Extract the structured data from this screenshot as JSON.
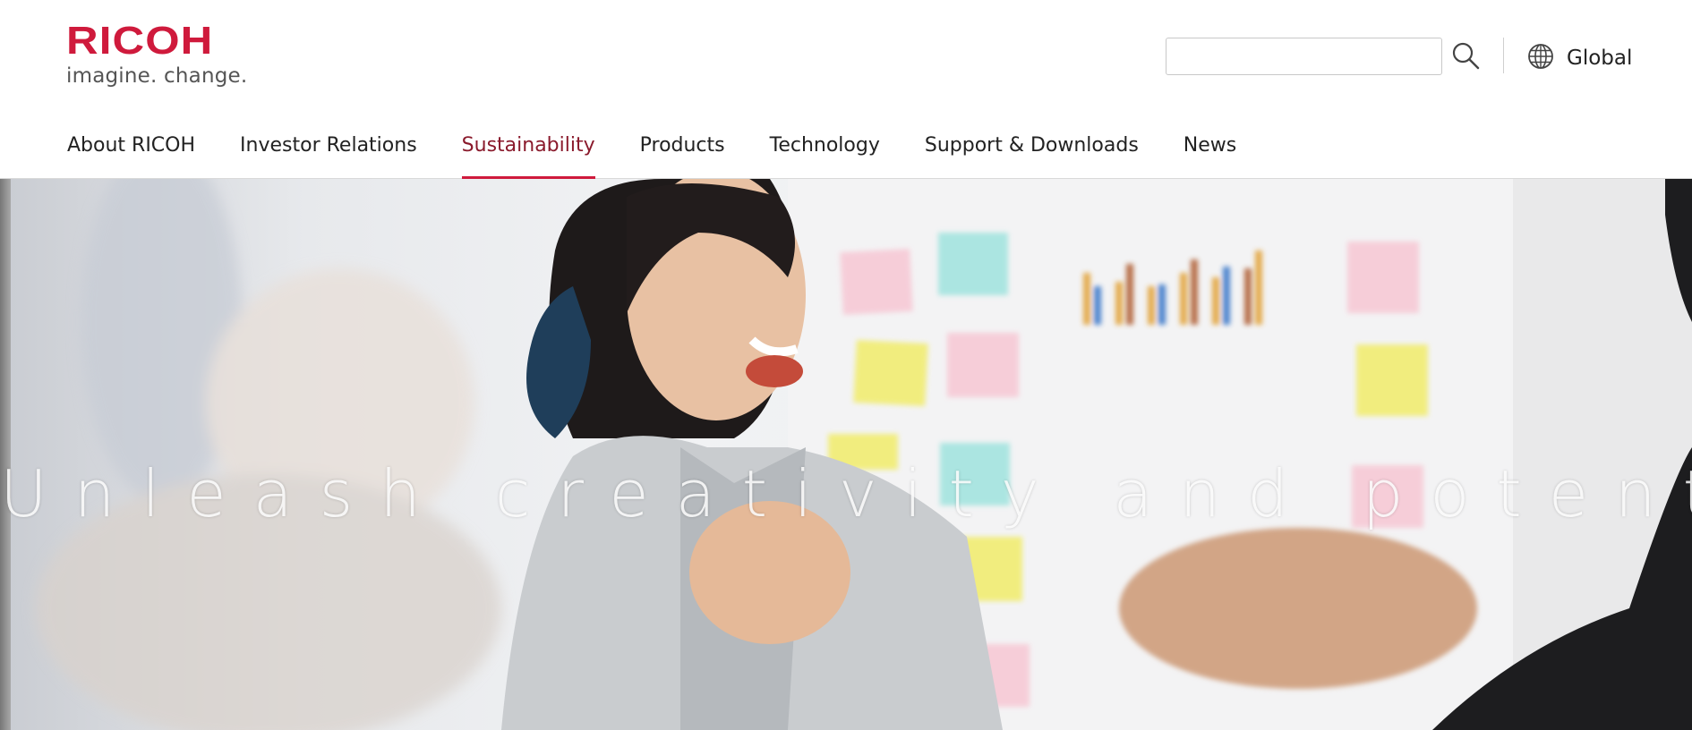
{
  "brand": {
    "name": "RICOH",
    "tagline": "imagine. change.",
    "color": "#cf1a3c"
  },
  "search": {
    "value": "",
    "placeholder": "",
    "icon": "search-icon"
  },
  "region": {
    "label": "Global",
    "icon": "globe-icon"
  },
  "nav": {
    "items": [
      {
        "label": "About RICOH",
        "active": false
      },
      {
        "label": "Investor Relations",
        "active": false
      },
      {
        "label": "Sustainability",
        "active": true
      },
      {
        "label": "Products",
        "active": false
      },
      {
        "label": "Technology",
        "active": false
      },
      {
        "label": "Support & Downloads",
        "active": false
      },
      {
        "label": "News",
        "active": false
      }
    ],
    "active_color": "#8a1a2c"
  },
  "hero": {
    "headline": "Unleash creativity and potential"
  }
}
